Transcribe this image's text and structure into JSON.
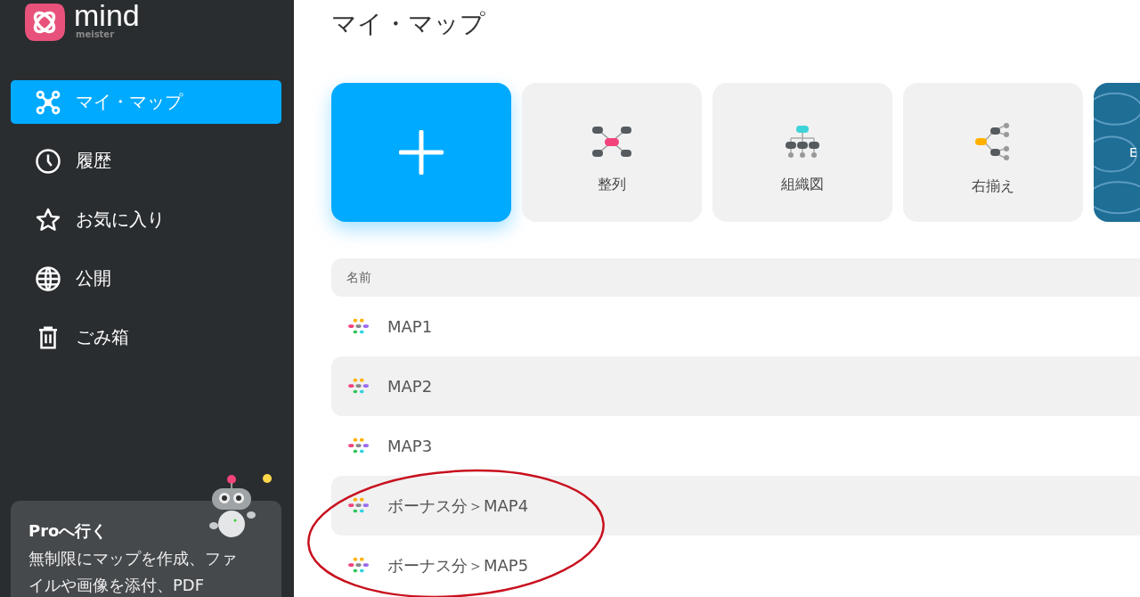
{
  "sidebar": {
    "logo": {
      "wordmark": "mind",
      "tagline": "meister"
    },
    "items": [
      {
        "label": "マイ・マップ",
        "kind": "map",
        "selected": true
      },
      {
        "label": "履歴",
        "kind": "clock",
        "selected": false
      },
      {
        "label": "お気に入り",
        "kind": "star",
        "selected": false
      },
      {
        "label": "公開",
        "kind": "globe",
        "selected": false
      },
      {
        "label": "ごみ箱",
        "kind": "trash",
        "selected": false
      }
    ],
    "promo": {
      "title": "Proへ行く",
      "text": "無制限にマップを作成、ファイルや画像を添付、PDF"
    }
  },
  "main": {
    "title": "マイ・マップ",
    "templates": [
      {
        "kind": "new"
      },
      {
        "kind": "mindmap",
        "label": "整列"
      },
      {
        "kind": "orgchart",
        "label": "組織図"
      },
      {
        "kind": "right",
        "label": "右揃え"
      },
      {
        "kind": "banner",
        "label": "E"
      }
    ],
    "table": {
      "columns": [
        "名前"
      ],
      "rows": [
        {
          "name": "MAP1"
        },
        {
          "name": "MAP2"
        },
        {
          "name": "MAP3"
        },
        {
          "name": "ボーナス分＞MAP4"
        },
        {
          "name": "ボーナス分＞MAP5"
        }
      ]
    }
  }
}
